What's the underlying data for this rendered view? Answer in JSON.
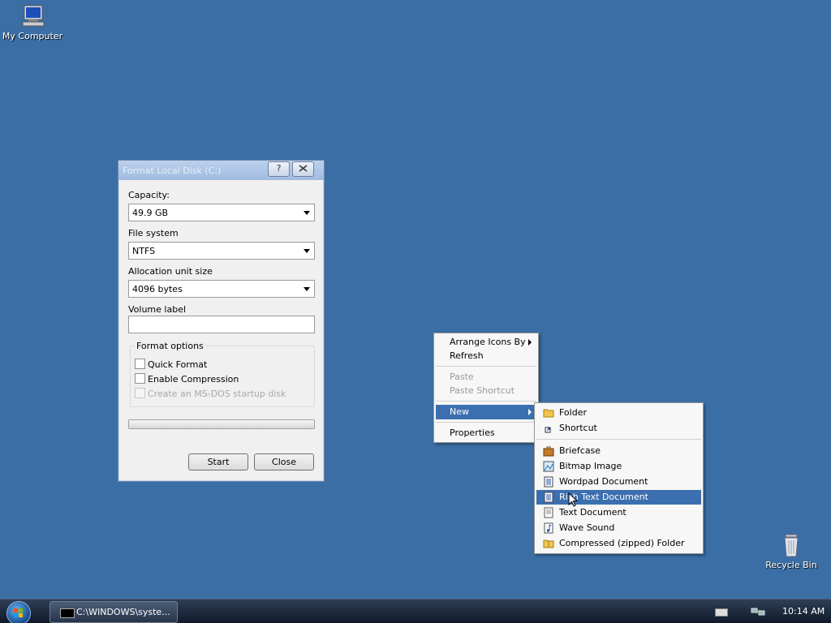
{
  "desktop": {
    "icons": [
      {
        "label": "My Computer"
      },
      {
        "label": "Recycle Bin"
      }
    ]
  },
  "dialog": {
    "title": "Format Local Disk (C:)",
    "help_button": "?",
    "capacity_label": "Capacity:",
    "capacity_value": "49.9 GB",
    "filesystem_label": "File system",
    "filesystem_value": "NTFS",
    "allocation_label": "Allocation unit size",
    "allocation_value": "4096 bytes",
    "volume_label": "Volume label",
    "volume_value": "",
    "format_options_label": "Format options",
    "options": [
      {
        "label": "Quick Format",
        "checked": false,
        "enabled": true
      },
      {
        "label": "Enable Compression",
        "checked": false,
        "enabled": true
      },
      {
        "label": "Create an MS-DOS startup disk",
        "checked": false,
        "enabled": false
      }
    ],
    "progress": 0,
    "start_button": "Start",
    "close_button": "Close"
  },
  "context_menu": {
    "items": [
      {
        "label": "Arrange Icons By",
        "submenu": true,
        "enabled": true
      },
      {
        "label": "Refresh",
        "enabled": true
      },
      {
        "label": "Paste",
        "enabled": false
      },
      {
        "label": "Paste Shortcut",
        "enabled": false
      },
      {
        "label": "New",
        "submenu": true,
        "highlighted": true
      },
      {
        "label": "Properties",
        "enabled": true
      }
    ]
  },
  "new_submenu": {
    "items": [
      {
        "label": "Folder",
        "icon": "folder-icon"
      },
      {
        "label": "Shortcut",
        "icon": "shortcut-icon"
      },
      {
        "label": "Briefcase",
        "icon": "briefcase-icon"
      },
      {
        "label": "Bitmap Image",
        "icon": "bitmap-icon"
      },
      {
        "label": "Wordpad Document",
        "icon": "wordpad-icon"
      },
      {
        "label": "Rich Text Document",
        "icon": "rich-text-icon",
        "highlighted": true
      },
      {
        "label": "Text Document",
        "icon": "text-document-icon"
      },
      {
        "label": "Wave Sound",
        "icon": "wave-sound-icon"
      },
      {
        "label": "Compressed (zipped) Folder",
        "icon": "zip-folder-icon"
      }
    ]
  },
  "taskbar": {
    "task_label": "C:\\WINDOWS\\syste...",
    "clock": "10:14 AM"
  },
  "colors": {
    "desktop": "#3a6ea5",
    "highlight": "#3c6fb0"
  }
}
